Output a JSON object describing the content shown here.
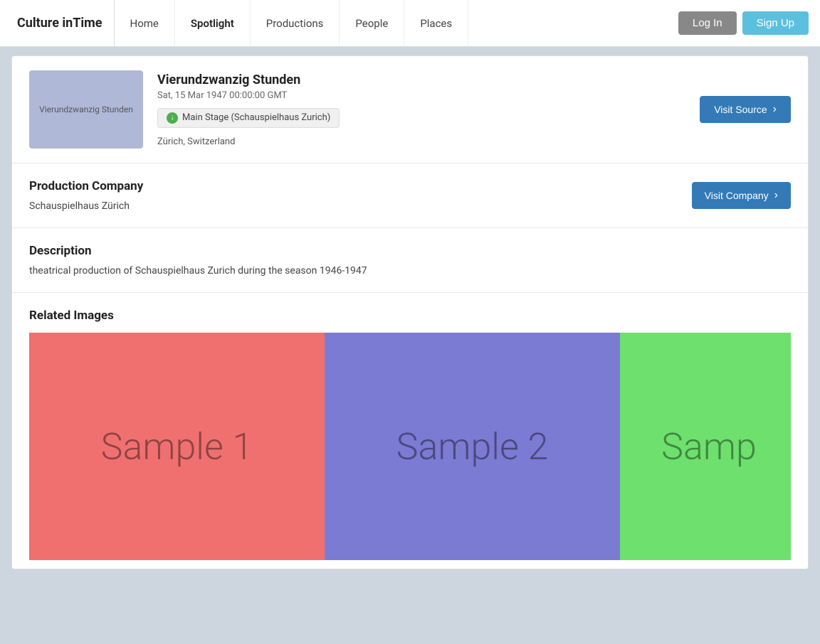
{
  "nav": {
    "brand": "Culture inTime",
    "links": [
      {
        "id": "home",
        "label": "Home",
        "active": false
      },
      {
        "id": "spotlight",
        "label": "Spotlight",
        "active": true
      },
      {
        "id": "productions",
        "label": "Productions",
        "active": false
      },
      {
        "id": "people",
        "label": "People",
        "active": false
      },
      {
        "id": "places",
        "label": "Places",
        "active": false
      }
    ],
    "login_label": "Log In",
    "signup_label": "Sign Up"
  },
  "event": {
    "thumbnail_text": "Vierundzwanzig Stunden",
    "title": "Vierundzwanzig Stunden",
    "date": "Sat, 15 Mar 1947 00:00:00 GMT",
    "venue": "Main Stage (Schauspielhaus Zurich)",
    "location": "Zürich, Switzerland",
    "visit_source_label": "Visit Source"
  },
  "production_company": {
    "section_title": "Production Company",
    "company_name": "Schauspielhaus Zürich",
    "visit_company_label": "Visit Company"
  },
  "description": {
    "section_title": "Description",
    "text": "theatrical production of Schauspielhaus Zurich during the season 1946-1947"
  },
  "related_images": {
    "section_title": "Related Images",
    "images": [
      {
        "id": "sample-1",
        "label": "Sample 1",
        "color": "#f07070"
      },
      {
        "id": "sample-2",
        "label": "Sample 2",
        "color": "#7b7bd4"
      },
      {
        "id": "sample-3",
        "label": "Samp",
        "color": "#6de06d"
      }
    ]
  }
}
